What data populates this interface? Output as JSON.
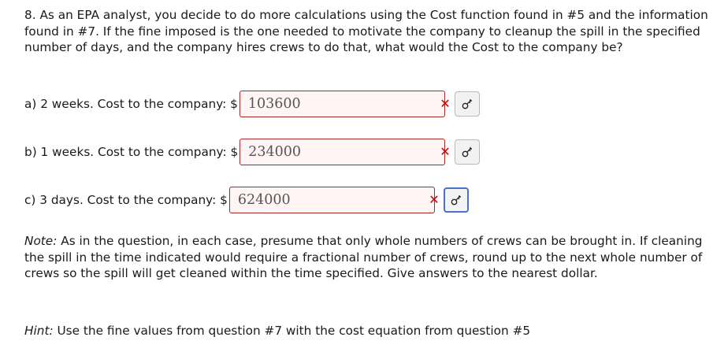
{
  "question": {
    "text": "8. As an EPA analyst, you decide to do more calculations using the Cost function found in #5 and the information found in #7. If the fine imposed is the one needed to motivate the company to cleanup the spill in the specified number of days, and the company hires crews to do that, what would the Cost to the company be?"
  },
  "parts": [
    {
      "label": "a) 2 weeks. Cost to the company: ",
      "currency": "$",
      "answer": "103600",
      "status": "incorrect",
      "status_icon": "incorrect-x-icon",
      "key_icon": "key-icon"
    },
    {
      "label": "b) 1 weeks. Cost to the company: ",
      "currency": "$",
      "answer": "234000",
      "status": "incorrect",
      "status_icon": "incorrect-x-icon",
      "key_icon": "key-icon"
    },
    {
      "label": "c) 3 days. Cost to the company: ",
      "currency": "$",
      "answer": "624000",
      "status": "incorrect",
      "status_icon": "incorrect-x-icon",
      "key_icon": "key-icon"
    }
  ],
  "note": {
    "prefix": "Note:",
    "text": " As in the question, in each case, presume that only whole numbers of crews can be brought in. If cleaning the spill in the time indicated would require a fractional number of crews, round up to the next whole number of crews so the spill will get cleaned within the time specified. Give answers to the nearest dollar."
  },
  "hint": {
    "prefix": "Hint:",
    "text": " Use the fine values from question #7 with the cost equation from question #5"
  },
  "colors": {
    "incorrect": "#cc0000",
    "box_border": "#a52a2a",
    "box_bg": "#fff5f5",
    "focus_ring": "#4a72c9"
  },
  "symbols": {
    "incorrect": "✕",
    "key": "⚷"
  }
}
